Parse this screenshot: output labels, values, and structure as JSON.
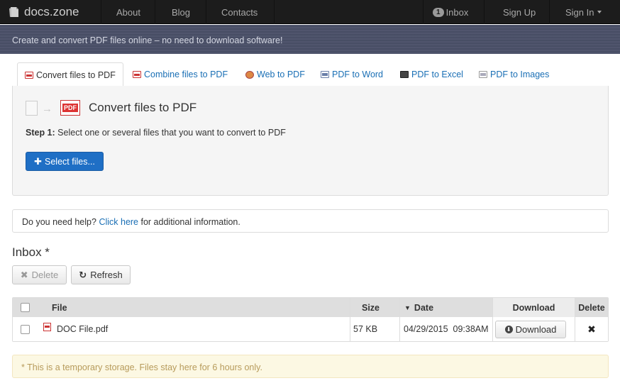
{
  "navbar": {
    "brand": "docs.zone",
    "links": [
      "About",
      "Blog",
      "Contacts"
    ],
    "inbox_count": "1",
    "inbox_label": "Inbox",
    "signup": "Sign Up",
    "signin": "Sign In"
  },
  "banner": {
    "text": "Create and convert PDF files online – no need to download software!"
  },
  "tabs": [
    {
      "label": "Convert files to PDF",
      "icon": "pdf-icon",
      "active": true
    },
    {
      "label": "Combine files to PDF",
      "icon": "pdf-icon",
      "active": false
    },
    {
      "label": "Web to PDF",
      "icon": "web-icon",
      "active": false
    },
    {
      "label": "PDF to Word",
      "icon": "word-icon",
      "active": false
    },
    {
      "label": "PDF to Excel",
      "icon": "excel-icon",
      "active": false
    },
    {
      "label": "PDF to Images",
      "icon": "image-icon",
      "active": false
    }
  ],
  "converter": {
    "title": "Convert files to PDF",
    "pdf_badge": "PDF",
    "step_label": "Step 1:",
    "step_text": "Select one or several files that you want to convert to PDF",
    "select_button": "Select files..."
  },
  "help": {
    "prefix": "Do you need help?",
    "link": "Click here",
    "suffix": "for additional information."
  },
  "inbox": {
    "title": "Inbox *",
    "delete_button": "Delete",
    "refresh_button": "Refresh",
    "columns": {
      "file": "File",
      "size": "Size",
      "date": "Date",
      "download": "Download",
      "delete": "Delete"
    },
    "rows": [
      {
        "file": "DOC File.pdf",
        "size": "57 KB",
        "date": "04/29/2015  09:38AM",
        "download_label": "Download"
      }
    ]
  },
  "notice": {
    "text": "* This is a temporary storage. Files stay here for 6 hours only."
  },
  "colors": {
    "navbar": "#1c1c1c",
    "banner": "#4a5068",
    "primary_button": "#1f6fc5",
    "link": "#1a6fb5",
    "notice_bg": "#fcf8e3",
    "notice_text": "#b79b5b"
  }
}
